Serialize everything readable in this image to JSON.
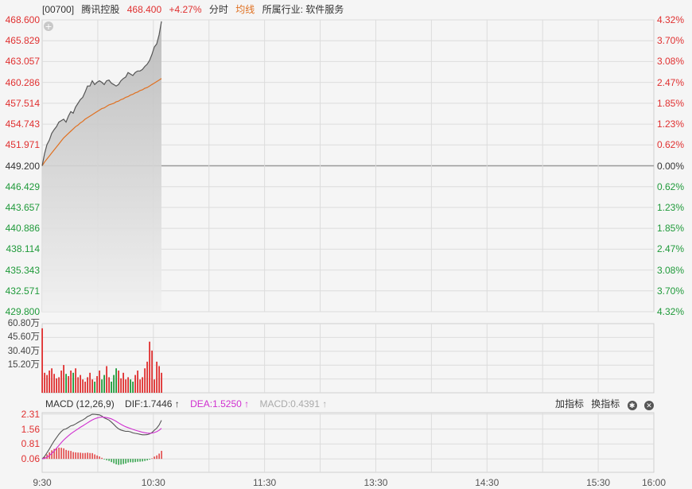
{
  "header": {
    "code": "[00700]",
    "name": "腾讯控股",
    "price": "468.400",
    "change": "+4.27%",
    "mode": "分时",
    "avg_line": "均线",
    "industry": "所属行业: 软件服务"
  },
  "colors": {
    "up": "#e03030",
    "down": "#1f9a3a",
    "price_line": "#555555",
    "avg_line": "#e07020",
    "dif_line": "#555555",
    "dea_line": "#d030d0"
  },
  "price_axis": {
    "left": [
      "468.600",
      "465.829",
      "463.057",
      "460.286",
      "457.514",
      "454.743",
      "451.971",
      "449.200",
      "446.429",
      "443.657",
      "440.886",
      "438.114",
      "435.343",
      "432.571",
      "429.800"
    ],
    "right": [
      "4.32%",
      "3.70%",
      "3.08%",
      "2.47%",
      "1.85%",
      "1.23%",
      "0.62%",
      "0.00%",
      "0.62%",
      "1.23%",
      "1.85%",
      "2.47%",
      "3.08%",
      "3.70%",
      "4.32%"
    ]
  },
  "volume_axis": [
    "60.80万",
    "45.60万",
    "30.40万",
    "15.20万"
  ],
  "macd": {
    "label": "MACD (12,26,9)",
    "dif": "DIF:1.7446",
    "dea": "DEA:1.5250",
    "macd": "MACD:0.4391",
    "axis": [
      "2.31",
      "1.56",
      "0.81",
      "0.06"
    ],
    "add_indicator": "加指标",
    "switch_indicator": "换指标"
  },
  "time_axis": [
    "9:30",
    "10:30",
    "11:30",
    "13:30",
    "14:30",
    "15:30",
    "16:00"
  ],
  "chart_data": {
    "type": "line",
    "title": "",
    "prev_close": 449.2,
    "ylim": [
      429.8,
      468.6
    ],
    "x_start": "9:30",
    "x_end": "16:00",
    "series": [
      {
        "values": [
          449.2,
          450.8,
          452.0,
          452.6,
          453.5,
          454.0,
          454.4,
          455.0,
          455.2,
          455.4,
          455.0,
          455.8,
          456.4,
          456.2,
          457.0,
          457.5,
          458.0,
          458.3,
          459.0,
          459.8,
          459.8,
          460.5,
          460.0,
          460.3,
          460.5,
          460.3,
          460.0,
          460.5,
          460.6,
          460.2,
          460.0,
          459.8,
          460.0,
          460.5,
          460.8,
          461.0,
          461.6,
          461.4,
          461.2,
          461.6,
          461.8,
          461.8,
          462.0,
          462.4,
          462.7,
          463.2,
          464.0,
          465.0,
          465.4,
          466.6,
          468.4
        ]
      },
      {
        "values": [
          449.2,
          449.7,
          450.1,
          450.5,
          450.9,
          451.3,
          451.7,
          452.1,
          452.5,
          452.9,
          453.2,
          453.5,
          453.8,
          454.1,
          454.4,
          454.6,
          454.9,
          455.1,
          455.4,
          455.6,
          455.8,
          456.0,
          456.2,
          456.4,
          456.6,
          456.8,
          456.9,
          457.1,
          457.3,
          457.4,
          457.5,
          457.7,
          457.8,
          458.0,
          458.1,
          458.3,
          458.4,
          458.6,
          458.7,
          458.9,
          459.0,
          459.2,
          459.3,
          459.5,
          459.6,
          459.8,
          460.0,
          460.2,
          460.4,
          460.6,
          460.8
        ]
      }
    ],
    "volume": [
      58,
      18,
      16,
      20,
      22,
      17,
      13,
      14,
      20,
      25,
      17,
      15,
      20,
      18,
      22,
      14,
      16,
      12,
      10,
      14,
      18,
      12,
      10,
      15,
      20,
      12,
      16,
      24,
      14,
      10,
      16,
      22,
      20,
      13,
      18,
      12,
      14,
      12,
      10,
      16,
      20,
      12,
      14,
      22,
      28,
      46,
      38,
      12,
      28,
      24,
      18
    ]
  }
}
